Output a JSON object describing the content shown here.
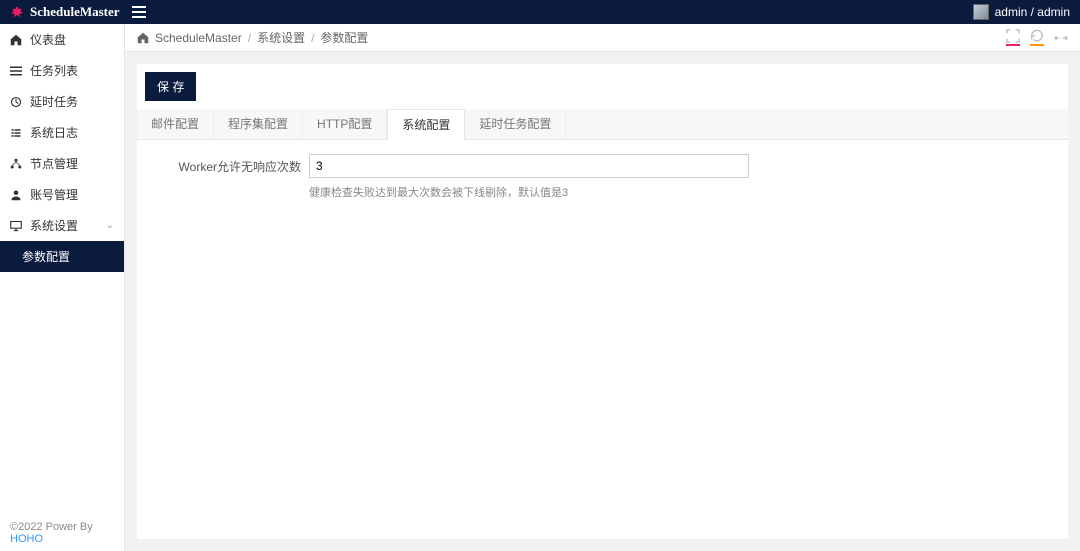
{
  "header": {
    "brand": "ScheduleMaster",
    "user_label": "admin / admin"
  },
  "sidebar": {
    "items": [
      {
        "icon": "dashboard",
        "label": "仪表盘"
      },
      {
        "icon": "list",
        "label": "任务列表"
      },
      {
        "icon": "clock",
        "label": "延时任务"
      },
      {
        "icon": "log",
        "label": "系统日志"
      },
      {
        "icon": "nodes",
        "label": "节点管理"
      },
      {
        "icon": "account",
        "label": "账号管理"
      },
      {
        "icon": "settings",
        "label": "系统设置"
      }
    ],
    "sub_item": {
      "label": "参数配置"
    },
    "footer_prefix": "©2022 Power By ",
    "footer_link": "HOHO"
  },
  "breadcrumb": [
    "ScheduleMaster",
    "系统设置",
    "参数配置"
  ],
  "content": {
    "save_label": "保 存",
    "tabs": [
      "邮件配置",
      "程序集配置",
      "HTTP配置",
      "系统配置",
      "延时任务配置"
    ],
    "active_tab": 3,
    "form": {
      "label": "Worker允许无响应次数",
      "value": "3",
      "hint": "健康检查失败达到最大次数会被下线剔除，默认值是3"
    }
  }
}
